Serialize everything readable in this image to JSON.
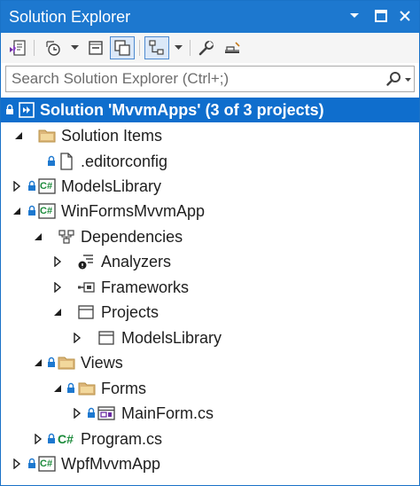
{
  "window": {
    "title": "Solution Explorer"
  },
  "search": {
    "placeholder": "Search Solution Explorer (Ctrl+;)"
  },
  "tree": {
    "solution": "Solution 'MvvmApps' (3 of 3 projects)",
    "solution_items": "Solution Items",
    "editorconfig": ".editorconfig",
    "models_library": "ModelsLibrary",
    "winforms_app": "WinFormsMvvmApp",
    "dependencies": "Dependencies",
    "analyzers": "Analyzers",
    "frameworks": "Frameworks",
    "projects": "Projects",
    "projects_models_library": "ModelsLibrary",
    "views": "Views",
    "forms": "Forms",
    "main_form": "MainForm.cs",
    "program": "Program.cs",
    "wpf_app": "WpfMvvmApp"
  },
  "icons": {
    "csharp_badge": "C#"
  },
  "colors": {
    "title_bar": "#1d78cf",
    "selection": "#0f6ecd",
    "folder": "#dcb67a",
    "csharp_green": "#1b8a3a"
  }
}
